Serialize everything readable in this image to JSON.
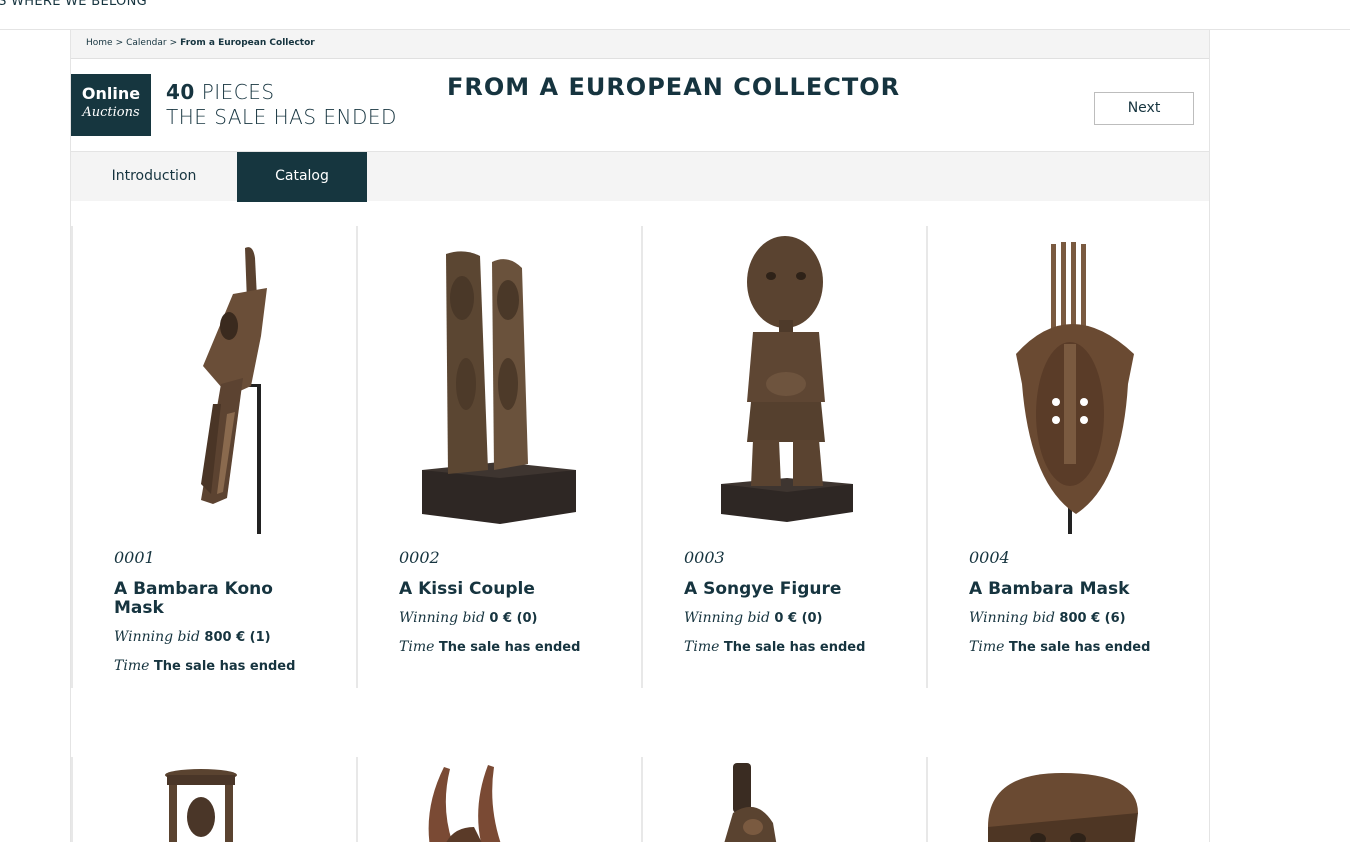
{
  "header": {
    "tagline": "IS WHERE WE BELONG"
  },
  "breadcrumb": {
    "home": "Home",
    "calendar": "Calendar",
    "current": "From a European Collector",
    "separator": ">"
  },
  "logo": {
    "line1": "Online",
    "line2": "Auctions"
  },
  "sale": {
    "count": "40",
    "count_label": "PIECES",
    "status": "THE SALE HAS ENDED",
    "title": "FROM A EUROPEAN COLLECTOR",
    "next_label": "Next"
  },
  "tabs": [
    {
      "label": "Introduction",
      "active": false
    },
    {
      "label": "Catalog",
      "active": true
    }
  ],
  "labels": {
    "winning_bid": "Winning bid",
    "time": "Time"
  },
  "lots": [
    {
      "lot": "0001",
      "title": "A Bambara Kono Mask",
      "bid": "800 € (1)",
      "time": "The sale has ended",
      "icon": "bambara-kono-mask-image"
    },
    {
      "lot": "0002",
      "title": "A Kissi Couple",
      "bid": "0 € (0)",
      "time": "The sale has ended",
      "icon": "kissi-couple-image"
    },
    {
      "lot": "0003",
      "title": "A Songye Figure",
      "bid": "0 € (0)",
      "time": "The sale has ended",
      "icon": "songye-figure-image"
    },
    {
      "lot": "0004",
      "title": "A Bambara Mask",
      "bid": "800 € (6)",
      "time": "The sale has ended",
      "icon": "bambara-mask-image"
    }
  ],
  "colors": {
    "brand": "#16363f",
    "light_bg": "#f4f4f4",
    "wood": "#5a4230"
  }
}
